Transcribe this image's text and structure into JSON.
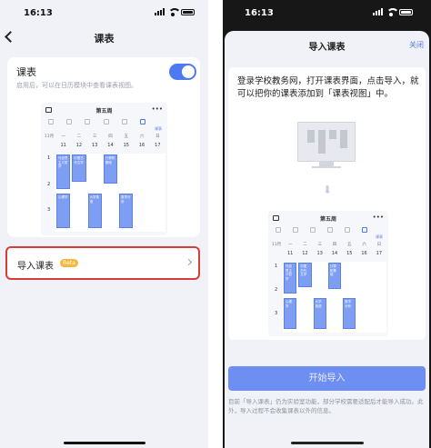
{
  "left": {
    "status": {
      "time": "16:13"
    },
    "nav": {
      "title": "课表"
    },
    "setting": {
      "title": "课表",
      "description": "启用后，可以在日历模块中查看课表视图。",
      "enabled": true
    },
    "preview": {
      "week_title": "第五周",
      "tab_label": "课表",
      "month": "11月",
      "weekdays": [
        "一",
        "二",
        "三",
        "四",
        "五",
        "六",
        "日"
      ],
      "dates": [
        "11",
        "12",
        "13",
        "14",
        "15",
        "16",
        "17"
      ],
      "rows": [
        "1",
        "2",
        "3"
      ],
      "blocks": [
        "马克思主义哲学",
        "中国古代文学",
        "计算机基础",
        "心理学",
        "大学英语",
        "数学分析"
      ]
    },
    "import_item": {
      "label": "导入课表",
      "badge": "Beta"
    }
  },
  "right": {
    "status": {
      "time": "16:13"
    },
    "sheet": {
      "title": "导入课表",
      "close_label": "关闭"
    },
    "guide": {
      "text": "登录学校教务网，打开课表界面，点击导入，就可以把你的课表添加到「课表视图」中。"
    },
    "preview": {
      "week_title": "第五周",
      "tab_label": "课表",
      "month": "11月",
      "weekdays": [
        "一",
        "二",
        "三",
        "四",
        "五",
        "六",
        "日"
      ],
      "dates": [
        "11",
        "12",
        "13",
        "14",
        "15",
        "16",
        "17"
      ],
      "rows": [
        "1",
        "2",
        "3"
      ],
      "blocks": [
        "马克思主义哲学",
        "中国古代文学",
        "计算机基础",
        "心理学",
        "大学英语",
        "数学分析"
      ]
    },
    "start_button": "开始导入",
    "note": "目前「导入课表」仍为实验室功能，部分学校需要适配后才能导入成功。此外，导入过程不会收集课表以外的信息。"
  },
  "colors": {
    "accent": "#4f79f0",
    "highlight": "#d93b3b",
    "badge": "#f4b73a"
  }
}
